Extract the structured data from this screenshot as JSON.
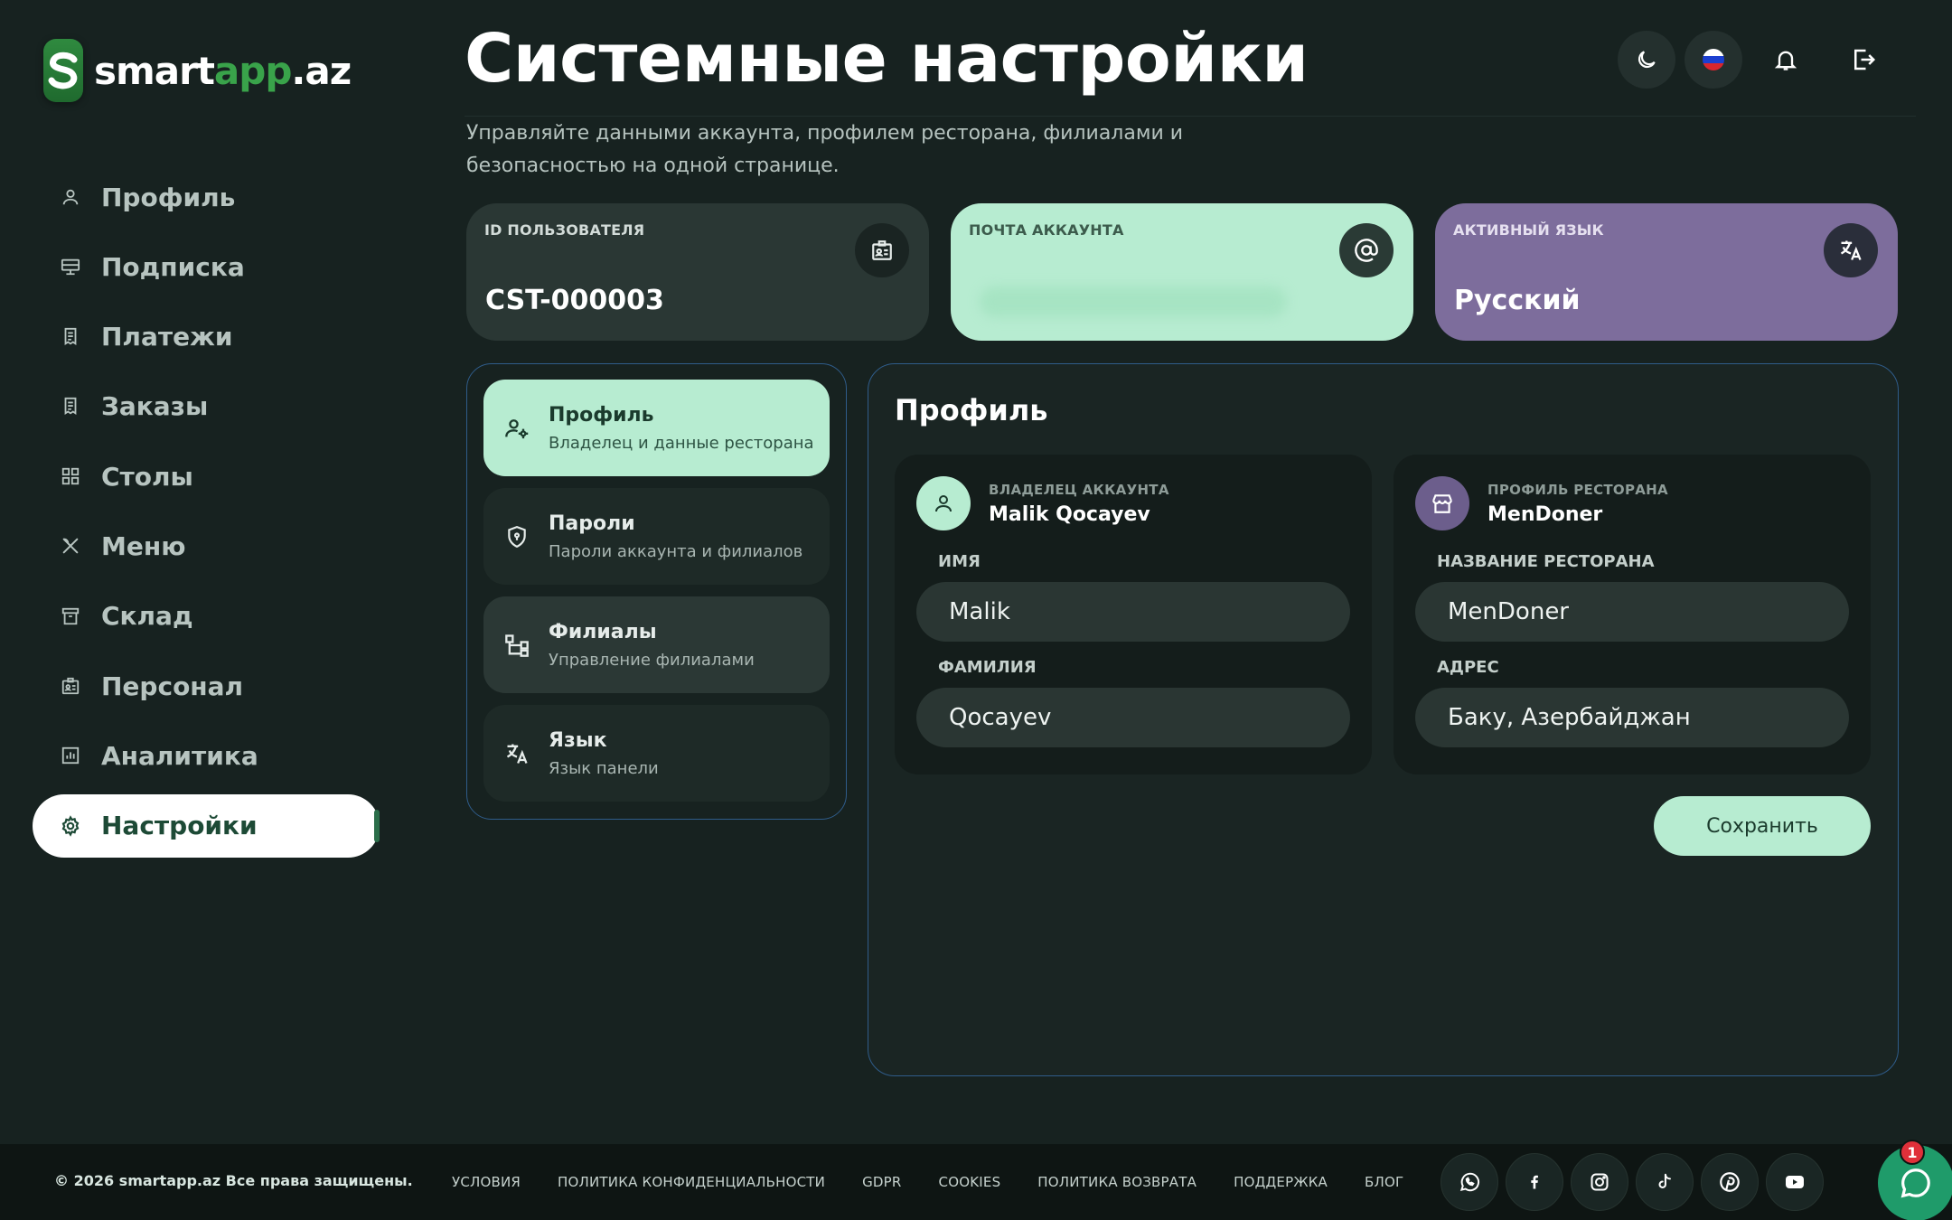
{
  "brand": {
    "logo_letter": "S",
    "part1": "smart",
    "part2": "app",
    "part3": ".az"
  },
  "sidebar": {
    "items": [
      {
        "label": "Профиль",
        "icon": "person-icon"
      },
      {
        "label": "Подписка",
        "icon": "monitor-icon"
      },
      {
        "label": "Платежи",
        "icon": "receipt-icon"
      },
      {
        "label": "Заказы",
        "icon": "receipt-icon"
      },
      {
        "label": "Столы",
        "icon": "grid-icon"
      },
      {
        "label": "Меню",
        "icon": "utensils-icon"
      },
      {
        "label": "Склад",
        "icon": "archive-icon"
      },
      {
        "label": "Персонал",
        "icon": "badge-icon"
      },
      {
        "label": "Аналитика",
        "icon": "chart-icon"
      },
      {
        "label": "Настройки",
        "icon": "gear-icon",
        "active": true
      }
    ]
  },
  "header": {
    "title": "Системные настройки",
    "subtitle": "Управляйте данными аккаунта, профилем ресторана, филиалами и безопасностью на одной странице.",
    "actions": [
      "theme-toggle",
      "language-flag",
      "notifications",
      "logout"
    ]
  },
  "info_cards": {
    "user_id": {
      "label": "ID ПОЛЬЗОВАТЕЛЯ",
      "value": "CST-000003"
    },
    "email": {
      "label": "ПОЧТА АККАУНТА",
      "value": ""
    },
    "language": {
      "label": "АКТИВНЫЙ ЯЗЫК",
      "value": "Русский"
    }
  },
  "settings_tabs": [
    {
      "title": "Профиль",
      "subtitle": "Владелец и данные ресторана",
      "active": true
    },
    {
      "title": "Пароли",
      "subtitle": "Пароли аккаунта и филиалов"
    },
    {
      "title": "Филиалы",
      "subtitle": "Управление филиалами"
    },
    {
      "title": "Язык",
      "subtitle": "Язык панели"
    }
  ],
  "profile": {
    "title": "Профиль",
    "owner": {
      "kicker": "ВЛАДЕЛЕЦ АККАУНТА",
      "name": "Malik Qocayev",
      "first_name_label": "ИМЯ",
      "first_name": "Malik",
      "last_name_label": "ФАМИЛИЯ",
      "last_name": "Qocayev"
    },
    "restaurant": {
      "kicker": "ПРОФИЛЬ РЕСТОРАНА",
      "name": "MenDoner",
      "name_label": "НАЗВАНИЕ РЕСТОРАНА",
      "restaurant_name": "MenDoner",
      "address_label": "АДРЕС",
      "address": "Баку, Азербайджан"
    },
    "save_label": "Сохранить"
  },
  "footer": {
    "copyright": "© 2026 smartapp.az Все права защищены.",
    "links": [
      "УСЛОВИЯ",
      "ПОЛИТИКА КОНФИДЕНЦИАЛЬНОСТИ",
      "GDPR",
      "COOKIES",
      "ПОЛИТИКА ВОЗВРАТА",
      "ПОДДЕРЖКА",
      "БЛОГ"
    ],
    "socials": [
      "whatsapp-icon",
      "facebook-icon",
      "instagram-icon",
      "tiktok-icon",
      "pinterest-icon",
      "youtube-icon"
    ],
    "chat_badge": "1"
  },
  "colors": {
    "background": "#172220",
    "accent_mint": "#b7ecd1",
    "accent_purple": "#7d6d9c",
    "brand_green": "#39a34a",
    "panel_border": "#2f5c8a"
  }
}
